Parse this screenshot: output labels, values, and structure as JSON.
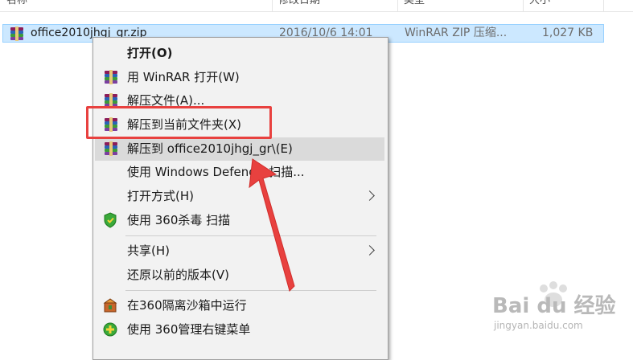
{
  "columns": {
    "name": "名称",
    "modified": "修改日期",
    "type": "类型",
    "size": "大小"
  },
  "file": {
    "name": "office2010jhgj_gr.zip",
    "modified": "2016/10/6 14:01",
    "type": "WinRAR ZIP 压缩...",
    "size": "1,027 KB"
  },
  "menu": {
    "items": [
      {
        "label": "打开(O)",
        "icon": "none"
      },
      {
        "label": "用 WinRAR 打开(W)",
        "icon": "winrar-icon"
      },
      {
        "label": "解压文件(A)...",
        "icon": "winrar-icon"
      },
      {
        "label": "解压到当前文件夹(X)",
        "icon": "winrar-icon"
      },
      {
        "label": "解压到 office2010jhgj_gr\\(E)",
        "icon": "winrar-icon"
      },
      {
        "label": "使用 Windows Defender扫描...",
        "icon": "none"
      },
      {
        "label": "打开方式(H)",
        "icon": "none",
        "submenu": true
      },
      {
        "label": "使用 360杀毒 扫描",
        "icon": "360-shield-icon"
      },
      {
        "label": "共享(H)",
        "icon": "none",
        "submenu": true
      },
      {
        "label": "还原以前的版本(V)",
        "icon": "none"
      },
      {
        "label": "在360隔离沙箱中运行",
        "icon": "360-sandbox-icon"
      },
      {
        "label": "使用 360管理右键菜单",
        "icon": "360-manager-icon"
      }
    ]
  },
  "watermark": {
    "text": "Bai du 经验",
    "sub": "jingyan.baidu.com"
  },
  "colors": {
    "selection": "#cce8ff",
    "highlight": "#e8413f",
    "menu_bg": "#f2f2f2"
  }
}
